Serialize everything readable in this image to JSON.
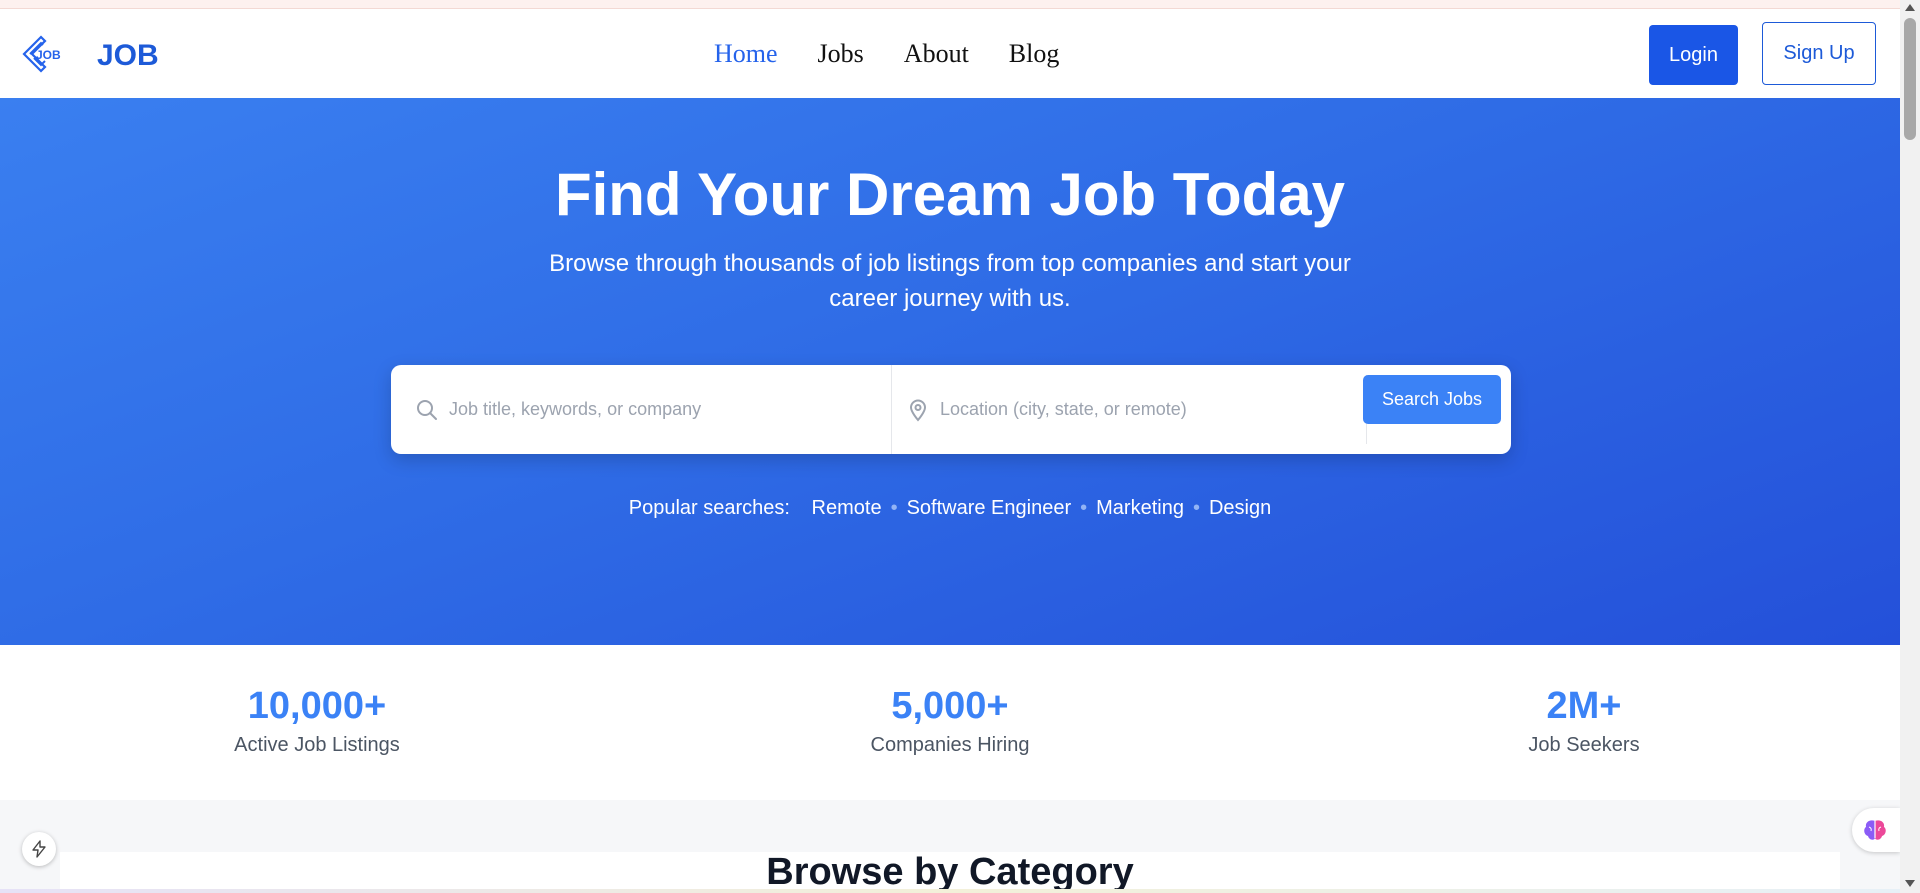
{
  "header": {
    "logo_text": "JOB",
    "brand": "JOB",
    "nav": [
      {
        "label": "Home",
        "active": true
      },
      {
        "label": "Jobs",
        "active": false
      },
      {
        "label": "About",
        "active": false
      },
      {
        "label": "Blog",
        "active": false
      }
    ],
    "login_label": "Login",
    "signup_label": "Sign Up"
  },
  "hero": {
    "title": "Find Your Dream Job Today",
    "subtitle": "Browse through thousands of job listings from top companies and start your career journey with us.",
    "search": {
      "keyword_placeholder": "Job title, keywords, or company",
      "location_placeholder": "Location (city, state, or remote)",
      "button_label": "Search Jobs"
    },
    "popular": {
      "label": "Popular searches:",
      "tags": [
        "Remote",
        "Software Engineer",
        "Marketing",
        "Design"
      ]
    }
  },
  "stats": [
    {
      "value": "10,000+",
      "label": "Active Job Listings"
    },
    {
      "value": "5,000+",
      "label": "Companies Hiring"
    },
    {
      "value": "2M+",
      "label": "Job Seekers"
    }
  ],
  "categories": {
    "title": "Browse by Category"
  },
  "icons": {
    "logo": "diamond-logo-icon",
    "search": "search-icon",
    "location": "map-pin-icon",
    "floating_left": "lightning-bolt-icon",
    "floating_right": "brain-icon"
  },
  "colors": {
    "brand_blue": "#1d5ad8",
    "primary_button": "#1a56e6",
    "accent_blue": "#3b82f6",
    "hero_gradient_start": "#3a7ff0",
    "hero_gradient_end": "#2450d9"
  }
}
